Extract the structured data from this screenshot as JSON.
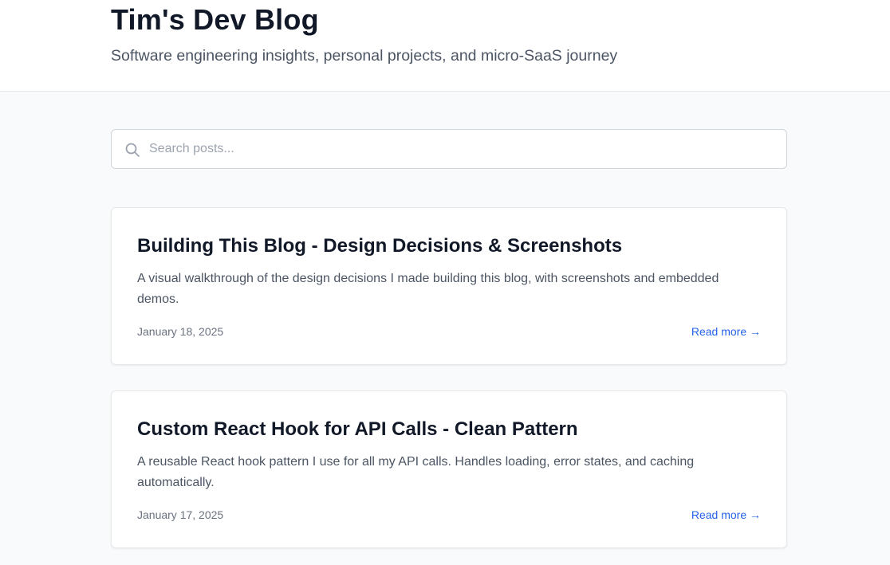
{
  "header": {
    "title": "Tim's Dev Blog",
    "subtitle": "Software engineering insights, personal projects, and micro-SaaS journey"
  },
  "search": {
    "placeholder": "Search posts...",
    "value": "",
    "icon": "search-icon"
  },
  "posts": [
    {
      "title": "Building This Blog - Design Decisions & Screenshots",
      "excerpt": "A visual walkthrough of the design decisions I made building this blog, with screenshots and embedded demos.",
      "date": "January 18, 2025",
      "read_more": "Read more →"
    },
    {
      "title": "Custom React Hook for API Calls - Clean Pattern",
      "excerpt": "A reusable React hook pattern I use for all my API calls. Handles loading, error states, and caching automatically.",
      "date": "January 17, 2025",
      "read_more": "Read more →"
    }
  ],
  "colors": {
    "accent_link": "#2563eb",
    "page_background": "#f9fafb",
    "card_background": "#ffffff",
    "title_text": "#111827",
    "body_text": "#4b5563"
  }
}
